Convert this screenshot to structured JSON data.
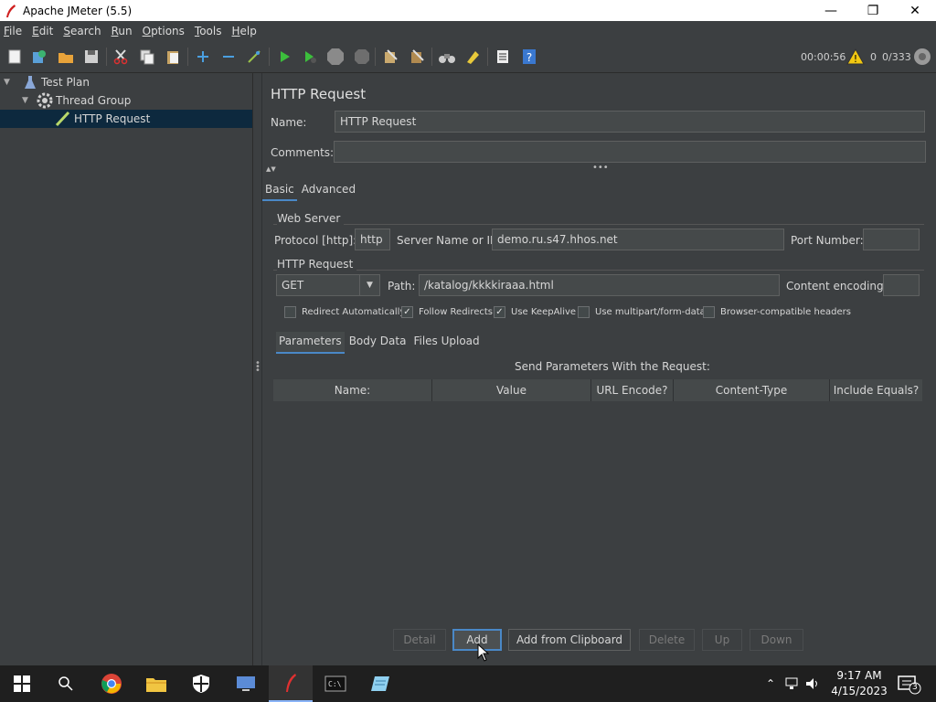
{
  "window": {
    "title": "Apache JMeter (5.5)"
  },
  "menu": [
    "File",
    "Edit",
    "Search",
    "Run",
    "Options",
    "Tools",
    "Help"
  ],
  "status": {
    "elapsed": "00:00:56",
    "warnings": "0",
    "threads": "0/333"
  },
  "tree": {
    "items": [
      {
        "label": "Test Plan",
        "icon": "flask-icon"
      },
      {
        "label": "Thread Group",
        "icon": "gear-icon"
      },
      {
        "label": "HTTP Request",
        "icon": "pen-icon"
      }
    ]
  },
  "panel": {
    "title": "HTTP Request",
    "name_label": "Name:",
    "name_value": "HTTP Request",
    "comments_label": "Comments:",
    "comments_value": "",
    "tabs": [
      "Basic",
      "Advanced"
    ],
    "web_server": {
      "section": "Web Server",
      "protocol_label": "Protocol [http]:",
      "protocol_value": "http",
      "server_label": "Server Name or IP:",
      "server_value": "demo.ru.s47.hhos.net",
      "port_label": "Port Number:",
      "port_value": ""
    },
    "http_request": {
      "section": "HTTP Request",
      "method": "GET",
      "path_label": "Path:",
      "path_value": "/katalog/kkkkiraaa.html",
      "encoding_label": "Content encoding:",
      "encoding_value": ""
    },
    "checkboxes": [
      {
        "label": "Redirect Automatically",
        "checked": false
      },
      {
        "label": "Follow Redirects",
        "checked": true
      },
      {
        "label": "Use KeepAlive",
        "checked": true
      },
      {
        "label": "Use multipart/form-data",
        "checked": false
      },
      {
        "label": "Browser-compatible headers",
        "checked": false
      }
    ],
    "subtabs": [
      "Parameters",
      "Body Data",
      "Files Upload"
    ],
    "table_caption": "Send Parameters With the Request:",
    "columns": [
      "Name:",
      "Value",
      "URL Encode?",
      "Content-Type",
      "Include Equals?"
    ],
    "buttons": {
      "detail": "Detail",
      "add": "Add",
      "add_clipboard": "Add from Clipboard",
      "delete": "Delete",
      "up": "Up",
      "down": "Down"
    }
  },
  "taskbar": {
    "time": "9:17 AM",
    "date": "4/15/2023",
    "notifications": "3"
  },
  "colors": {
    "accent": "#4a88c7",
    "panel_bg": "#3c3f41",
    "selection": "#0d293e"
  }
}
